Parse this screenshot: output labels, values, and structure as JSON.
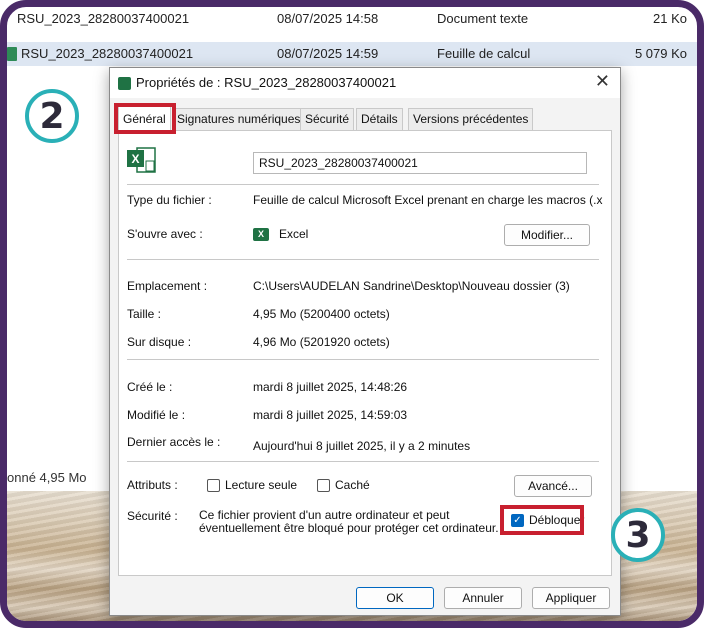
{
  "explorer": {
    "rows": [
      {
        "name": "RSU_2023_28280037400021",
        "date": "08/07/2025 14:58",
        "type": "Document texte",
        "size": "21 Ko"
      },
      {
        "name": "RSU_2023_28280037400021",
        "date": "08/07/2025 14:59",
        "type": "Feuille de calcul",
        "size": "5 079 Ko"
      }
    ],
    "status": "onné 4,95 Mo"
  },
  "callouts": {
    "step2": "2",
    "step3": "3"
  },
  "dialog": {
    "title": "Propriétés de : RSU_2023_28280037400021",
    "close": "✕",
    "tabs": [
      "Général",
      "Signatures numériques",
      "Sécurité",
      "Détails",
      "Versions précédentes"
    ],
    "filename": "RSU_2023_28280037400021",
    "fields": {
      "type_label": "Type du fichier :",
      "type_value": "Feuille de calcul Microsoft Excel prenant en charge les macros (.x",
      "opens_label": "S'ouvre avec :",
      "opens_value": "Excel",
      "modify_button": "Modifier...",
      "location_label": "Emplacement :",
      "location_value": "C:\\Users\\AUDELAN Sandrine\\Desktop\\Nouveau dossier (3)",
      "size_label": "Taille :",
      "size_value": "4,95 Mo (5200400 octets)",
      "disk_label": "Sur disque :",
      "disk_value": "4,96 Mo (5201920 octets)",
      "created_label": "Créé le :",
      "created_value": "mardi 8 juillet 2025, 14:48:26",
      "modified_label": "Modifié le :",
      "modified_value": "mardi 8 juillet 2025, 14:59:03",
      "accessed_label": "Dernier accès le :",
      "accessed_value": "Aujourd'hui 8 juillet 2025, il y a 2 minutes",
      "attributes_label": "Attributs :",
      "readonly_label": "Lecture seule",
      "hidden_label": "Caché",
      "advanced_button": "Avancé...",
      "security_label": "Sécurité :",
      "security_line1": "Ce fichier provient d'un autre ordinateur et peut",
      "security_line2": "éventuellement être bloqué pour protéger cet ordinateur.",
      "unblock_label": "Débloquer"
    },
    "buttons": {
      "ok": "OK",
      "cancel": "Annuler",
      "apply": "Appliquer"
    }
  },
  "colors": {
    "frame": "#4a2a68",
    "callout_border": "#2ab0b7",
    "highlight": "#c8202f",
    "accent": "#0067c0",
    "excel": "#1f7244"
  }
}
